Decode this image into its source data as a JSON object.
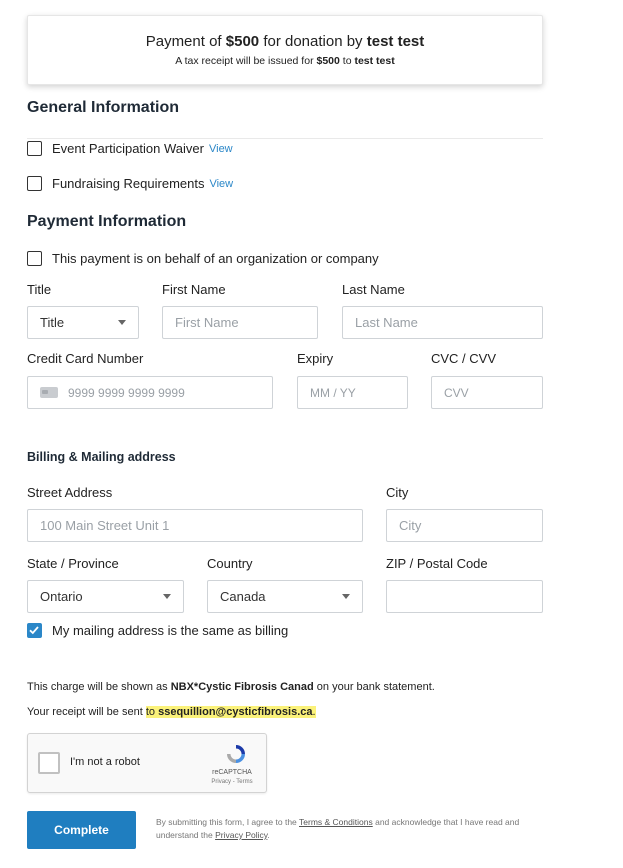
{
  "summary": {
    "line1_prefix": "Payment of",
    "amount": "$500",
    "line1_middle": "for donation by",
    "donor": "test test",
    "line2_prefix": "A tax receipt will be issued for",
    "line2_amount": "$500",
    "line2_to": "to",
    "line2_donor": "test test"
  },
  "general": {
    "heading": "General Information",
    "waiver_label": "Event Participation Waiver",
    "waiver_link": "View",
    "fundraising_label": "Fundraising Requirements",
    "fundraising_link": "View"
  },
  "payment": {
    "heading": "Payment Information",
    "org_label": "This payment is on behalf of an organization or company",
    "title_label": "Title",
    "title_value": "Title",
    "first_label": "First Name",
    "first_placeholder": "First Name",
    "last_label": "Last Name",
    "last_placeholder": "Last Name",
    "cc_label": "Credit Card Number",
    "cc_placeholder": "9999 9999 9999 9999",
    "expiry_label": "Expiry",
    "expiry_placeholder": "MM / YY",
    "cvc_label": "CVC / CVV",
    "cvc_placeholder": "CVV"
  },
  "billing": {
    "heading": "Billing & Mailing address",
    "street_label": "Street Address",
    "street_placeholder": "100 Main Street Unit 1",
    "city_label": "City",
    "city_placeholder": "City",
    "state_label": "State / Province",
    "state_value": "Ontario",
    "country_label": "Country",
    "country_value": "Canada",
    "zip_label": "ZIP / Postal Code",
    "zip_value": "",
    "same_label": "My mailing address is the same as billing"
  },
  "notes": {
    "charge_prefix": "This charge will be shown as",
    "charge_name": "NBX*Cystic Fibrosis Canad",
    "charge_suffix": "on your bank statement.",
    "receipt_prefix": "Your receipt will be sent",
    "receipt_to": "to",
    "receipt_email": "ssequillion@cysticfibrosis.ca",
    "receipt_period": "."
  },
  "captcha": {
    "label": "I'm not a robot",
    "brand": "reCAPTCHA",
    "links": "Privacy - Terms"
  },
  "footer": {
    "complete_label": "Complete",
    "legal_1": "By submitting this form, I agree to the",
    "terms": "Terms & Conditions",
    "legal_2": "and acknowledge that I have read and understand the",
    "privacy": "Privacy Policy",
    "legal_end": "."
  },
  "colors": {
    "accent": "#2b87c8",
    "button": "#1f7ec0",
    "highlight": "#fbf27a"
  }
}
